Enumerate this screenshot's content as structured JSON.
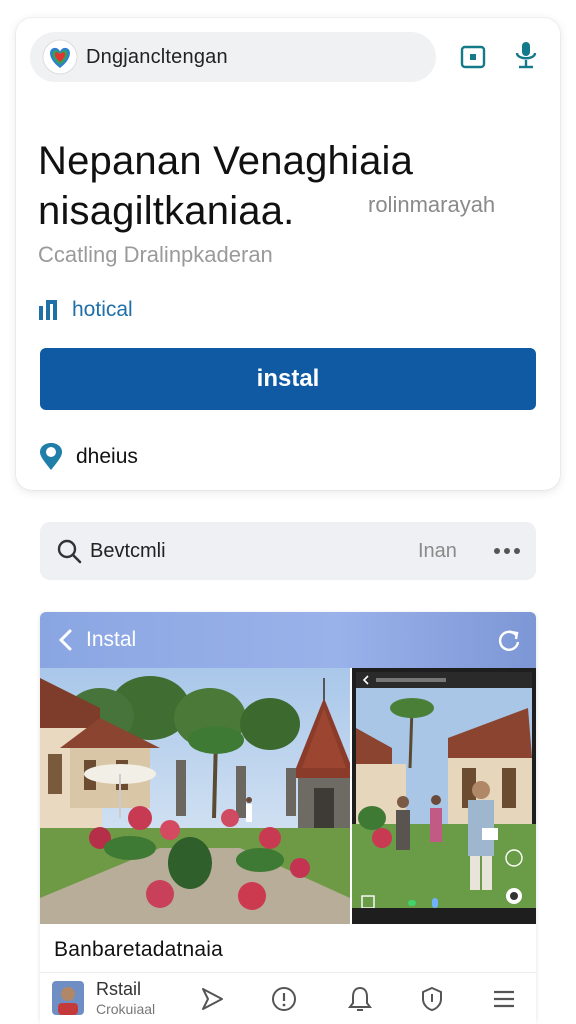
{
  "header": {
    "search_text": "Dngjancltengan",
    "icons": [
      "heart-logo-icon",
      "cast-icon",
      "microphone-icon"
    ]
  },
  "hero": {
    "headline_line1": "Nepanan Venaghiaia",
    "headline_line2": "nisagiltkaniaa.",
    "headline_side": "rolinmarayah",
    "subtitle": "Ccatling Dralinpkaderan",
    "feature_label": "hotical",
    "install_label": "instal",
    "location_label": "dheius"
  },
  "search": {
    "text": "Bevtcmli",
    "right_label": "Inan"
  },
  "media": {
    "header_label": "Instal",
    "caption": "Banbaretadatnaia"
  },
  "bottom_nav": {
    "title": "Rstail",
    "subtitle": "Crokuiaal",
    "items": [
      "send-icon",
      "info-icon",
      "bell-icon",
      "shield-icon",
      "menu-icon"
    ]
  },
  "colors": {
    "primary": "#0f5aa3",
    "feature_text": "#1f6fa8",
    "header_gradient": "#8aa6e2",
    "pill_bg": "#f0f1f3"
  }
}
